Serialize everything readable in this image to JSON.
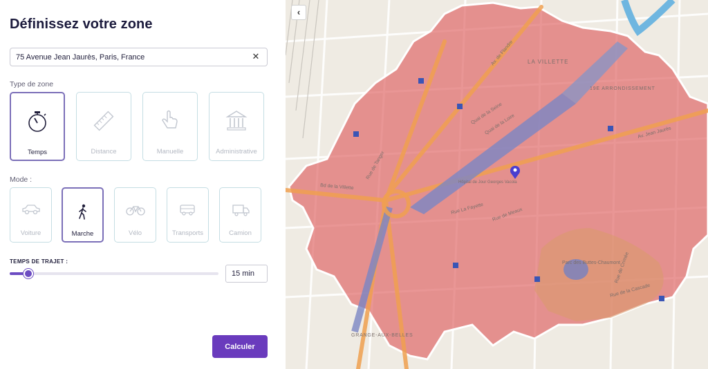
{
  "panel": {
    "title": "Définissez votre zone",
    "address": {
      "value": "75 Avenue Jean Jaurès, Paris, France",
      "clear_icon": "close-icon"
    },
    "zone_type_label": "Type de zone",
    "zone_types": [
      {
        "label": "Temps",
        "icon": "stopwatch-icon",
        "active": true
      },
      {
        "label": "Distance",
        "icon": "ruler-icon",
        "active": false
      },
      {
        "label": "Manuelle",
        "icon": "hand-pointer-icon",
        "active": false
      },
      {
        "label": "Administrative",
        "icon": "government-building-icon",
        "active": false
      }
    ],
    "mode_label": "Mode :",
    "modes": [
      {
        "label": "Voiture",
        "icon": "car-icon",
        "active": false
      },
      {
        "label": "Marche",
        "icon": "walking-person-icon",
        "active": true
      },
      {
        "label": "Vélo",
        "icon": "bicycle-icon",
        "active": false
      },
      {
        "label": "Transports",
        "icon": "bus-icon",
        "active": false
      },
      {
        "label": "Camion",
        "icon": "truck-icon",
        "active": false
      }
    ],
    "travel_time_label": "TEMPS DE TRAJET :",
    "travel_time_value": "15 min",
    "slider_fraction": 0.09,
    "submit_label": "Calculer"
  },
  "map": {
    "back_icon": "chevron-left-icon",
    "marker_icon": "location-pin-icon",
    "colors": {
      "zone": "#e06a6a",
      "accent": "#6a3bbd",
      "marker": "#4a3fd0"
    },
    "labels": {
      "la_villette": "LA VILLETTE",
      "arrondissement": "19E ARRONDISSEMENT",
      "grange": "GRANGE-AUX-BELLES",
      "parc": "Parc des Buttes-Chaumont",
      "rue_jean_jaures": "Av. Jean Jaurès",
      "bd_villette": "Bd de la Villette",
      "quai_loire": "Quai de la Loire",
      "quai_seine": "Quai de la Seine",
      "rue_lafayette": "Rue La Fayette",
      "rue_tanger": "Rue de Tanger",
      "av_flandre": "Av. de Flandre",
      "rue_crimee": "Rue de Crimée",
      "rue_cascade": "Rue de la Cascade",
      "rue_meaux": "Rue de Meaux",
      "hopital": "Hôpital de Jour Georges Vacola"
    }
  }
}
